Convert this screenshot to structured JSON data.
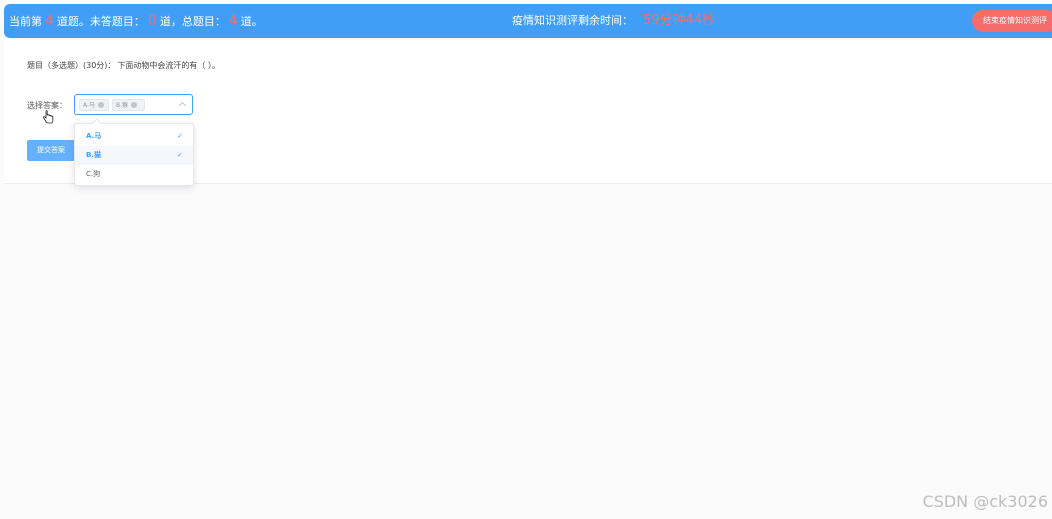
{
  "header": {
    "current_prefix": "当前第",
    "current_num": "4",
    "current_suffix": "道题。未答题目：",
    "unanswered_num": "0",
    "unanswered_suffix": "道，总题目：",
    "total_num": "4",
    "total_suffix": "道。",
    "timer_label": "疫情知识测评剩余时间：",
    "timer_value": "59分钟44秒",
    "end_button": "结束疫情知识测评"
  },
  "question": {
    "type_label": "题目（多选题）(30分)：",
    "text": "下面动物中会流汗的有（ ）。"
  },
  "answer": {
    "label": "选择答案：",
    "selected_tags": [
      "A.马",
      "B.猴"
    ],
    "options": [
      {
        "label": "A.马",
        "selected": true
      },
      {
        "label": "B.猫",
        "selected": true
      },
      {
        "label": "C.狗",
        "selected": false
      }
    ]
  },
  "submit_button": "提交答案",
  "watermark": "CSDN @ck3026",
  "colors": {
    "header_bg": "#419ef7",
    "accent_red": "#f56c6c",
    "primary": "#409eff"
  }
}
